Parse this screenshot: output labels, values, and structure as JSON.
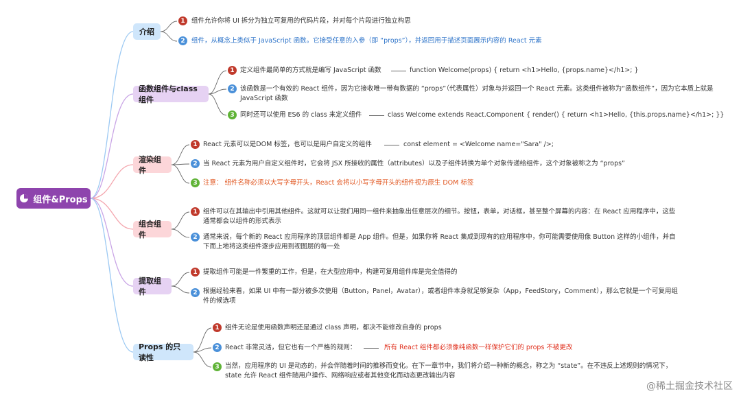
{
  "root": {
    "icon": "pie-chart-icon",
    "label": "组件&Props"
  },
  "sections": [
    {
      "label": "介绍",
      "items": [
        {
          "n": "1",
          "text": "组件允许你将 UI 拆分为独立可复用的代码片段，并对每个片段进行独立构思"
        },
        {
          "n": "2",
          "text": "组件，从概念上类似于 JavaScript 函数。它接受任意的入参（即 “props”），并返回用于描述页面展示内容的 React 元素"
        }
      ]
    },
    {
      "label": "函数组件与class组件",
      "items": [
        {
          "n": "1",
          "text": "定义组件最简单的方式就是编写 JavaScript 函数",
          "extra": "function Welcome(props) {  return <h1>Hello, {props.name}</h1>; }"
        },
        {
          "n": "2",
          "text": "该函数是一个有效的 React 组件，因为它接收唯一带有数据的 “props”（代表属性）对象与并返回一个 React 元素。这类组件被称为“函数组件”，因为它本质上就是 JavaScript 函数"
        },
        {
          "n": "3",
          "text": "同时还可以使用 ES6 的 class 来定义组件",
          "extra": "class Welcome extends React.Component {  render() {    return <h1>Hello, {this.props.name}</h1>;  }}"
        }
      ]
    },
    {
      "label": "渲染组件",
      "items": [
        {
          "n": "1",
          "text": "React 元素可以是DOM 标签，也可以是用户自定义的组件",
          "extra": "const element = <Welcome name=\"Sara\" />;"
        },
        {
          "n": "2",
          "text": "当 React 元素为用户自定义组件时，它会将 JSX 所接收的属性（attributes）以及子组件转换为单个对象传递给组件，这个对象被称之为 “props”"
        },
        {
          "n": "3",
          "text": "注意：  组件名称必须以大写字母开头，React 会将以小写字母开头的组件视为原生 DOM 标签"
        }
      ]
    },
    {
      "label": "组合组件",
      "items": [
        {
          "n": "1",
          "text": "组件可以在其输出中引用其他组件。这就可以让我们用同一组件来抽象出任意层次的细节。按钮，表单，对话框，甚至整个屏幕的内容：在 React 应用程序中，这些通常都会以组件的形式表示"
        },
        {
          "n": "2",
          "text": "通常来说，每个新的 React 应用程序的顶层组件都是 App 组件。但是，如果你将 React 集成到现有的应用程序中，你可能需要使用像 Button 这样的小组件，并自下而上地将这类组件逐步应用到视图层的每一处"
        }
      ]
    },
    {
      "label": "提取组件",
      "items": [
        {
          "n": "1",
          "text": "提取组件可能是一件繁重的工作，但是，在大型应用中，构建可复用组件库是完全值得的"
        },
        {
          "n": "2",
          "text": "根据经验来看，如果 UI 中有一部分被多次使用（Button，Panel，Avatar），或者组件本身就足够复杂（App，FeedStory，Comment），那么它就是一个可复用组件的候选项"
        }
      ]
    },
    {
      "label": "Props 的只读性",
      "items": [
        {
          "n": "1",
          "text": "组件无论是使用函数声明还是通过 class 声明，都决不能修改自身的 props"
        },
        {
          "n": "2",
          "text": "React 非常灵活，但它也有一个严格的规则：",
          "extra": "所有 React 组件都必须像纯函数一样保护它们的 props 不被更改"
        },
        {
          "n": "3",
          "text": "当然，应用程序的 UI 是动态的，并会伴随着时间的推移而变化。在下一章节中，我们将介绍一种新的概念，称之为 “state”。在不违反上述规则的情况下，state 允许 React 组件随用户操作、网络响应或者其他变化而动态更改输出内容"
        }
      ]
    }
  ],
  "watermark": "@稀土掘金技术社区",
  "colors": {
    "root": "#8e44ad",
    "intro": "#cfe6fb",
    "func": "#e6d2f3",
    "render": "#fcd6d9",
    "compose": "#fcd6d9",
    "extract": "#e6d2f3",
    "readonly": "#cfe6fb",
    "badge_red": "#c0392b",
    "badge_blue": "#4a90d9",
    "badge_green": "#5fb336"
  }
}
